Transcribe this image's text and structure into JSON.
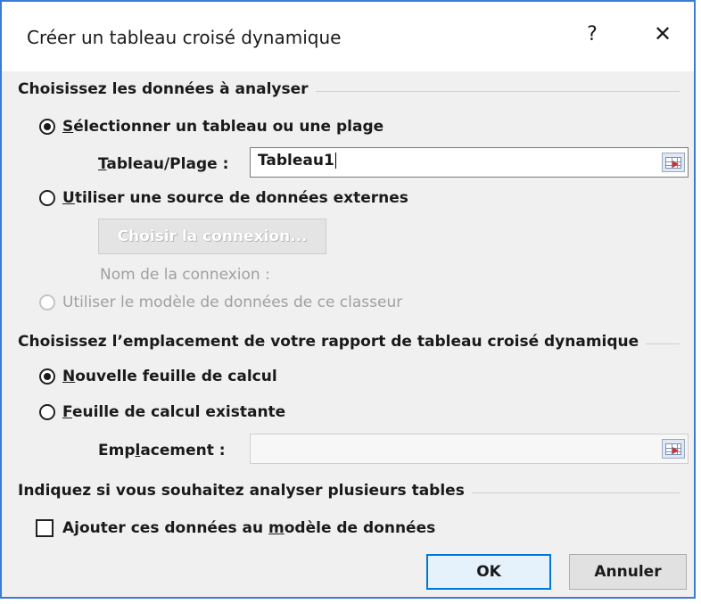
{
  "dialog": {
    "title": "Créer un tableau croisé dynamique",
    "help_label": "?",
    "close_label": "✕"
  },
  "section_data": {
    "label": "Choisissez les données à analyser",
    "option_table": {
      "accel": "S",
      "rest": "électionner un tableau ou une plage",
      "selected": true
    },
    "table_range": {
      "label_accel": "T",
      "label_rest": "ableau/Plage :",
      "value": "Tableau1"
    },
    "option_external": {
      "accel": "U",
      "rest": "tiliser une source de données externes",
      "selected": false
    },
    "choose_connection_label": "Choisir la connexion...",
    "connection_name_label": "Nom de la connexion :",
    "option_data_model": {
      "label": "Utiliser le modèle de données de ce classeur",
      "enabled": false
    }
  },
  "section_location": {
    "label": "Choisissez l’emplacement de votre rapport de tableau croisé dynamique",
    "option_new_sheet": {
      "accel": "N",
      "rest": "ouvelle feuille de calcul",
      "selected": true
    },
    "option_existing_sheet": {
      "accel": "F",
      "rest": "euille de calcul existante",
      "selected": false
    },
    "location_field": {
      "label_pre": "Emp",
      "label_accel": "l",
      "label_post": "acement :",
      "value": ""
    }
  },
  "section_multiple": {
    "label": "Indiquez si vous souhaitez analyser plusieurs tables",
    "add_to_model": {
      "pre": "Ajouter ces données au ",
      "accel": "m",
      "post": "odèle de données",
      "checked": false
    }
  },
  "buttons": {
    "ok_label": "OK",
    "cancel_label": "Annuler"
  },
  "colors": {
    "accent": "#0078d7",
    "window_border": "#3a7bd5",
    "dialog_bg": "#f0f0f0"
  }
}
